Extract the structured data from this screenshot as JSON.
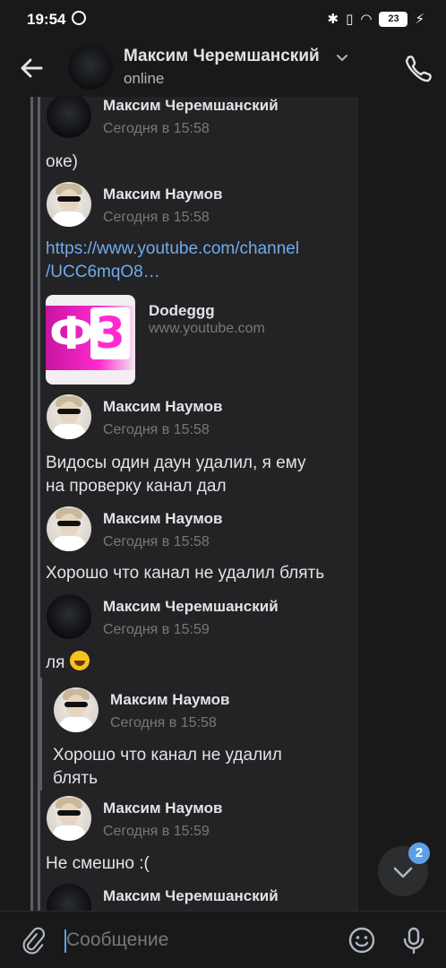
{
  "status_bar": {
    "time": "19:54",
    "battery": "23"
  },
  "header": {
    "name": "Максим Черемшанский",
    "status": "online"
  },
  "messages": [
    {
      "author": "Максим Черемшанский",
      "time": "Сегодня в 15:58",
      "text": "оке)"
    },
    {
      "author": "Максим Наумов",
      "time": "Сегодня в 15:58",
      "link_line1": "https://www.youtube.com/channel",
      "link_line2": "/UCC6mqO8…",
      "snippet": {
        "title": "Dodeggg",
        "domain": "www.youtube.com"
      }
    },
    {
      "author": "Максим Наумов",
      "time": "Сегодня в 15:58",
      "text_line1": "Видосы один даун удалил, я ему",
      "text_line2": "на проверку канал дал"
    },
    {
      "author": "Максим Наумов",
      "time": "Сегодня в 15:58",
      "text": "Хорошо что канал не удалил блять"
    },
    {
      "author": "Максим Черемшанский",
      "time": "Сегодня в 15:59",
      "text": "ля",
      "quote": {
        "author": "Максим Наумов",
        "time": "Сегодня в 15:58",
        "text_line1": "Хорошо что канал не удалил",
        "text_line2": "блять"
      }
    },
    {
      "author": "Максим Наумов",
      "time": "Сегодня в 15:59",
      "text": "Не смешно :("
    },
    {
      "author": "Максим Черемшанский"
    }
  ],
  "scroll_badge": "2",
  "composer": {
    "placeholder": "Сообщение"
  },
  "colors": {
    "background": "#19191a",
    "panel": "#232325",
    "link": "#71aaeb",
    "accent": "#5da0e8"
  },
  "icons": [
    "back-arrow-icon",
    "chevron-down-icon",
    "phone-icon",
    "paperclip-icon",
    "smile-icon",
    "microphone-icon",
    "chevron-down-icon"
  ]
}
